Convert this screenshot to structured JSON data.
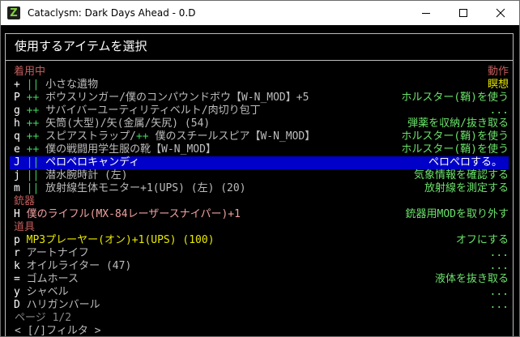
{
  "window": {
    "title": "Cataclysm: Dark Days Ahead - 0.D",
    "icon_letter": "Z"
  },
  "menu": {
    "header": "使用するアイテムを選択"
  },
  "sections": {
    "worn": {
      "label": "着用中",
      "action_header": "動作"
    },
    "weapon": {
      "label": "銃器"
    },
    "items": {
      "label": "道具"
    }
  },
  "rows": [
    {
      "key": "+",
      "mark": "||",
      "name": "小さな遺物",
      "action": "瞑想"
    },
    {
      "key": "P",
      "mark": "++",
      "name": "ボウスリンガー/僕のコンパウンドボウ【W-N_MOD】+5",
      "action": "ホルスター(鞘)を使う"
    },
    {
      "key": "g",
      "mark": "++",
      "name": "サバイバーユーティリティベルト/肉切り包丁",
      "action": "..."
    },
    {
      "key": "h",
      "mark": "++",
      "name": "矢筒(大型)/矢(金属/矢尻) (54)",
      "action": "弾薬を収納/抜き取る"
    },
    {
      "key": "q",
      "mark": "++",
      "name_a": "スピアストラップ/",
      "name_b": "++",
      "name_c": " 僕のスチールスピア【W-N_MOD】",
      "action": "ホルスター(鞘)を使う"
    },
    {
      "key": "e",
      "mark": "++",
      "name": "僕の戦闘用学生服の靴【W-N_MOD】",
      "action": "ホルスター(鞘)を使う"
    },
    {
      "key": "J",
      "mark": "||",
      "name": "ペロペロキャンディ",
      "action": "ペロペロする。"
    },
    {
      "key": "j",
      "mark": "||",
      "name": "潜水腕時計 (左)",
      "action": "気象情報を確認する"
    },
    {
      "key": "m",
      "mark": "||",
      "name": "放射線生体モニター+1(UPS) (左) (20)",
      "action": "放射線を測定する"
    },
    {
      "key": "H",
      "name": "僕のライフル(MX-84レーザースナイパー)+1",
      "action": "銃器用MODを取り外す"
    },
    {
      "key": "p",
      "name": "MP3プレーヤー(オン)+1(UPS) (100)",
      "action": "オフにする"
    },
    {
      "key": "r",
      "name": "アートナイフ",
      "action": "..."
    },
    {
      "key": "k",
      "name": "オイルライター (47)",
      "action": "..."
    },
    {
      "key": "=",
      "name": "ゴムホース",
      "action": "液体を抜き取る"
    },
    {
      "key": "y",
      "name": "シャベル",
      "action": "..."
    },
    {
      "key": "D",
      "name": "ハリガンバール",
      "action": "..."
    }
  ],
  "footer": {
    "page": "ページ 1/2",
    "filter": "< [/]フィルタ >"
  },
  "colors": {
    "selection": "#0000c8",
    "green": "#3cd05a",
    "section": "#c35c5c",
    "yellow": "#e8e800"
  }
}
